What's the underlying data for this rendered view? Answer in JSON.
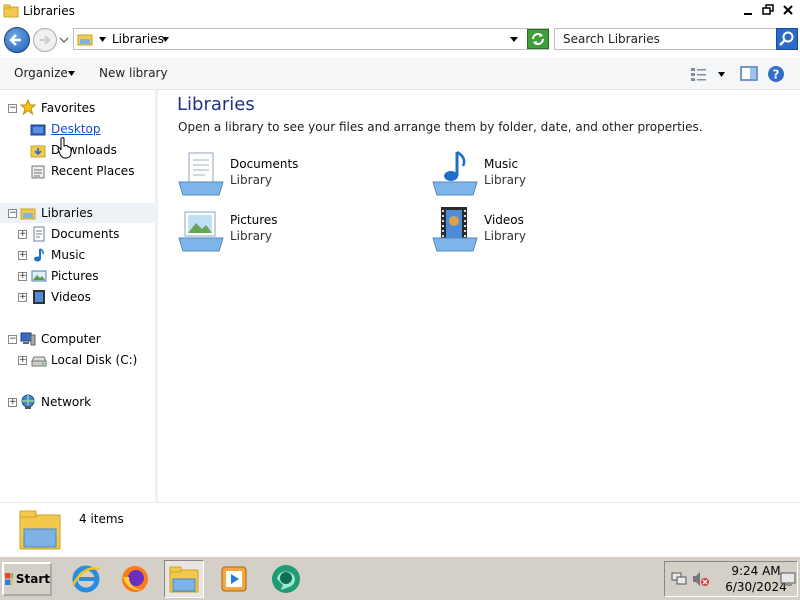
{
  "window": {
    "title": "Libraries"
  },
  "address": {
    "crumb": "Libraries"
  },
  "search": {
    "placeholder": "Search Libraries"
  },
  "toolbar": {
    "organize": "Organize",
    "new_library": "New library"
  },
  "nav": {
    "favorites": "Favorites",
    "desktop": "Desktop",
    "downloads": "Downloads",
    "recent": "Recent Places",
    "libraries": "Libraries",
    "documents": "Documents",
    "music": "Music",
    "pictures": "Pictures",
    "videos": "Videos",
    "computer": "Computer",
    "local_disk": "Local Disk (C:)",
    "network": "Network"
  },
  "content": {
    "heading": "Libraries",
    "subheading": "Open a library to see your files and arrange them by folder, date, and other properties.",
    "libraries": [
      {
        "name": "Documents",
        "kind": "Library"
      },
      {
        "name": "Music",
        "kind": "Library"
      },
      {
        "name": "Pictures",
        "kind": "Library"
      },
      {
        "name": "Videos",
        "kind": "Library"
      }
    ]
  },
  "details": {
    "count": "4 items"
  },
  "taskbar": {
    "start": "Start",
    "time": "9:24 AM",
    "date": "6/30/2024"
  },
  "colors": {
    "accent": "#1a5fb4",
    "link": "#0b56c7",
    "heading": "#1e3287"
  }
}
